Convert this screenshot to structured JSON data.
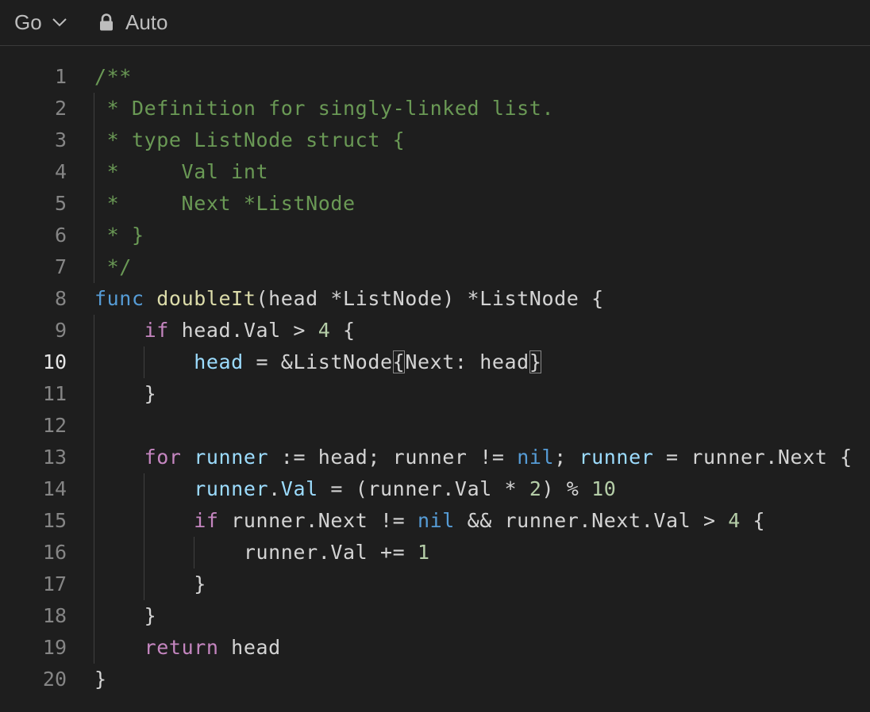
{
  "toolbar": {
    "language_label": "Go",
    "mode_label": "Auto"
  },
  "editor": {
    "active_line": 10,
    "lines": [
      {
        "number": "1",
        "tokens": [
          {
            "t": "/**",
            "c": "comment"
          }
        ]
      },
      {
        "number": "2",
        "tokens": [
          {
            "t": " * Definition for singly-linked list.",
            "c": "comment"
          }
        ]
      },
      {
        "number": "3",
        "tokens": [
          {
            "t": " * type ListNode struct {",
            "c": "comment"
          }
        ]
      },
      {
        "number": "4",
        "tokens": [
          {
            "t": " *     Val int",
            "c": "comment"
          }
        ]
      },
      {
        "number": "5",
        "tokens": [
          {
            "t": " *     Next *ListNode",
            "c": "comment"
          }
        ]
      },
      {
        "number": "6",
        "tokens": [
          {
            "t": " * }",
            "c": "comment"
          }
        ]
      },
      {
        "number": "7",
        "tokens": [
          {
            "t": " */",
            "c": "comment"
          }
        ]
      },
      {
        "number": "8",
        "tokens": [
          {
            "t": "func",
            "c": "kw"
          },
          {
            "t": " ",
            "c": "plain"
          },
          {
            "t": "doubleIt",
            "c": "fn"
          },
          {
            "t": "(head *ListNode) *ListNode {",
            "c": "plain"
          }
        ]
      },
      {
        "number": "9",
        "tokens": [
          {
            "t": "    ",
            "c": "plain"
          },
          {
            "t": "if",
            "c": "ctrl"
          },
          {
            "t": " head.Val > ",
            "c": "plain"
          },
          {
            "t": "4",
            "c": "num"
          },
          {
            "t": " {",
            "c": "plain"
          }
        ]
      },
      {
        "number": "10",
        "tokens": [
          {
            "t": "        ",
            "c": "plain"
          },
          {
            "t": "head",
            "c": "var"
          },
          {
            "t": " = &ListNode",
            "c": "plain"
          },
          {
            "t": "{",
            "c": "plain",
            "box": true
          },
          {
            "t": "Next: head",
            "c": "plain"
          },
          {
            "t": "}",
            "c": "plain",
            "box": true
          }
        ]
      },
      {
        "number": "11",
        "tokens": [
          {
            "t": "    }",
            "c": "plain"
          }
        ]
      },
      {
        "number": "12",
        "tokens": []
      },
      {
        "number": "13",
        "tokens": [
          {
            "t": "    ",
            "c": "plain"
          },
          {
            "t": "for",
            "c": "ctrl"
          },
          {
            "t": " ",
            "c": "plain"
          },
          {
            "t": "runner",
            "c": "var"
          },
          {
            "t": " := head; runner != ",
            "c": "plain"
          },
          {
            "t": "nil",
            "c": "kw"
          },
          {
            "t": "; ",
            "c": "plain"
          },
          {
            "t": "runner",
            "c": "var"
          },
          {
            "t": " = runner.Next {",
            "c": "plain"
          }
        ]
      },
      {
        "number": "14",
        "tokens": [
          {
            "t": "        ",
            "c": "plain"
          },
          {
            "t": "runner",
            "c": "var"
          },
          {
            "t": ".",
            "c": "plain"
          },
          {
            "t": "Val",
            "c": "var"
          },
          {
            "t": " = (runner.Val * ",
            "c": "plain"
          },
          {
            "t": "2",
            "c": "num"
          },
          {
            "t": ") % ",
            "c": "plain"
          },
          {
            "t": "10",
            "c": "num"
          }
        ]
      },
      {
        "number": "15",
        "tokens": [
          {
            "t": "        ",
            "c": "plain"
          },
          {
            "t": "if",
            "c": "ctrl"
          },
          {
            "t": " runner.Next != ",
            "c": "plain"
          },
          {
            "t": "nil",
            "c": "kw"
          },
          {
            "t": " && runner.Next.Val > ",
            "c": "plain"
          },
          {
            "t": "4",
            "c": "num"
          },
          {
            "t": " {",
            "c": "plain"
          }
        ]
      },
      {
        "number": "16",
        "tokens": [
          {
            "t": "            runner.Val += ",
            "c": "plain"
          },
          {
            "t": "1",
            "c": "num"
          }
        ]
      },
      {
        "number": "17",
        "tokens": [
          {
            "t": "        }",
            "c": "plain"
          }
        ]
      },
      {
        "number": "18",
        "tokens": [
          {
            "t": "    }",
            "c": "plain"
          }
        ]
      },
      {
        "number": "19",
        "tokens": [
          {
            "t": "    ",
            "c": "plain"
          },
          {
            "t": "return",
            "c": "ctrl"
          },
          {
            "t": " head",
            "c": "plain"
          }
        ]
      },
      {
        "number": "20",
        "tokens": [
          {
            "t": "}",
            "c": "plain"
          }
        ]
      }
    ]
  },
  "colors": {
    "background": "#1e1e1e",
    "comment": "#6a9955",
    "keyword": "#569cd6",
    "control": "#c586c0",
    "function": "#dcdcaa",
    "variable": "#9cdcfe",
    "number": "#b5cea8",
    "text": "#d4d4d4"
  },
  "icons": {
    "language_dropdown": "chevron-down-icon",
    "mode": "lock-icon"
  }
}
